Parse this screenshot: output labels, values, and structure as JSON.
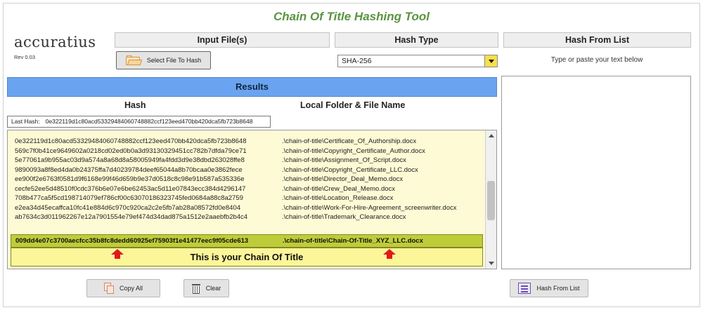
{
  "app": {
    "title": "Chain Of Title Hashing Tool",
    "logo": "accuratius",
    "revision": "Rev 0.03"
  },
  "columns": {
    "input_files": "Input File(s)",
    "hash_type": "Hash Type",
    "hash_from_list": "Hash From List"
  },
  "input": {
    "select_file_label": "Select File To Hash"
  },
  "hash_type": {
    "selected": "SHA-256"
  },
  "hash_list": {
    "hint": "Type or paste your text below",
    "text": ""
  },
  "results": {
    "title": "Results",
    "hash_header": "Hash",
    "location_header": "Local Folder & File Name",
    "last_hash_label": "Last Hash:",
    "last_hash_value": "0e322119d1c80acd53329484060748882ccf123eed470bb420dca5fb723b8648",
    "rows": [
      {
        "hash": "0e322119d1c80acd53329484060748882ccf123eed470bb420dca5fb723b8648",
        "file": ".\\chain-of-title\\Certificate_Of_Authorship.docx"
      },
      {
        "hash": "569c7f0b41ce9649602a0218cd02ed0b0a3d93130329451cc782b7dfda79ce71",
        "file": ".\\chain-of-title\\Copyright_Certificate_Author.docx"
      },
      {
        "hash": "5e77061a9b955ac03d9a574a8a68d8a58005949fa4fdd3d9e38dbd263028ffe8",
        "file": ".\\chain-of-title\\Assignment_Of_Script.docx"
      },
      {
        "hash": "9890093a8f8ed4da0b24375ffa7d40239784deef65044a8b70bcaa0e3862fece",
        "file": ".\\chain-of-title\\Copyright_Certificate_LLC.docx"
      },
      {
        "hash": "ee900f2e6763f0581d9f6168e99f46d659b9e37d0518c8c98e91b587a535336e",
        "file": ".\\chain-of-title\\Director_Deal_Memo.docx"
      },
      {
        "hash": "cecfe52ee5d48510f0cdc376b6e07e6be62453ac5d11e07843ecc384d4296147",
        "file": ".\\chain-of-title\\Crew_Deal_Memo.docx"
      },
      {
        "hash": "708b477ca5f5cd198714079ef786cf00c63070186323745fed0684a88c8a2759",
        "file": ".\\chain-of-title\\Location_Release.docx"
      },
      {
        "hash": "e2ea34d45ecaffca10fc41e884d6c970c920ca2c2e5fb7ab28a08572fd0e8404",
        "file": ".\\chain-of-title\\Work-For-Hire-Agreement_screenwriter.docx"
      },
      {
        "hash": "ab7634c3d011962267e12a7901554e79ef474d34dad875a1512e2aaebfb2b4c4",
        "file": ".\\chain-of-title\\Trademark_Clearance.docx"
      }
    ],
    "chain": {
      "hash": "009dd4e07c3700aecfcc35b8fc8dedd60925ef75903f1e41477eec9f05cde613",
      "file": ".\\chain-of-title\\Chain-Of-Title_XYZ_LLC.docx",
      "label": "This is your Chain Of Title"
    }
  },
  "actions": {
    "copy_all": "Copy All",
    "clear": "Clear",
    "hash_from_list": "Hash From List"
  },
  "colors": {
    "title_green": "#5a9440",
    "results_blue": "#6aa4f0",
    "chain_highlight": "#bfcc3a",
    "list_background": "#fdfad5",
    "arrow_red": "#e01a1a"
  }
}
